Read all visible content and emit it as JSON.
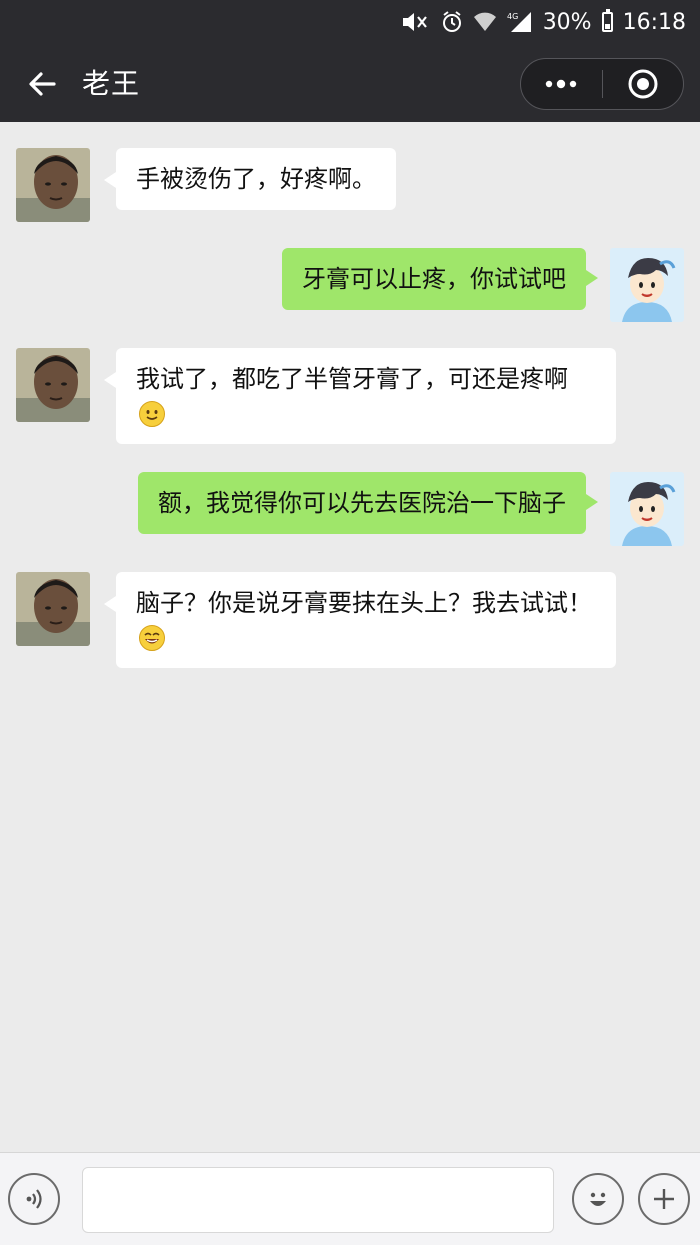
{
  "status_bar": {
    "battery": "30%",
    "time": "16:18",
    "battery_level": 0.3
  },
  "header": {
    "title": "老王"
  },
  "messages": [
    {
      "from": "other",
      "text": "手被烫伤了，好疼啊。"
    },
    {
      "from": "me",
      "text": "牙膏可以止疼，你试试吧"
    },
    {
      "from": "other",
      "text": "我试了，都吃了半管牙膏了，可还是疼啊",
      "emoji": "smile-emoji"
    },
    {
      "from": "me",
      "text": "额，我觉得你可以先去医院治一下脑子"
    },
    {
      "from": "other",
      "text": "脑子？你是说牙膏要抹在头上？我去试试！",
      "emoji": "laugh-emoji"
    }
  ],
  "input": {
    "value": ""
  },
  "colors": {
    "bar": "#2b2b2f",
    "chat_bg": "#ebebeb",
    "outgoing": "#9fe66a",
    "incoming": "#ffffff"
  }
}
